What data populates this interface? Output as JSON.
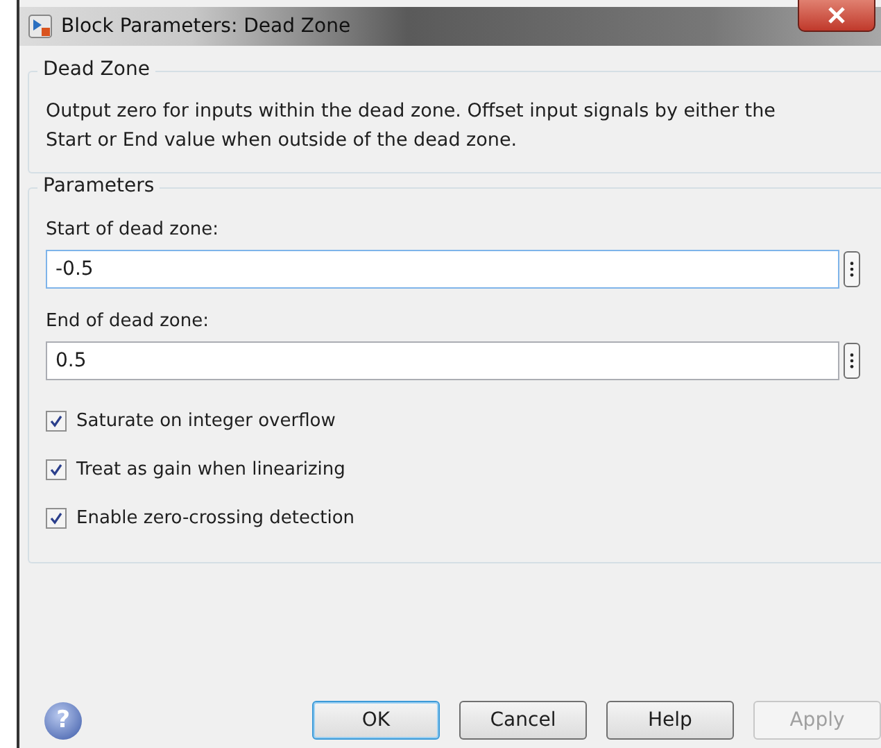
{
  "window": {
    "title": "Block Parameters: Dead Zone"
  },
  "description_group": {
    "title": "Dead Zone",
    "text": "Output zero for inputs within the dead zone.  Offset input signals by either the Start or End value when outside of the dead zone."
  },
  "parameters_group": {
    "title": "Parameters",
    "fields": [
      {
        "label": "Start of dead zone:",
        "value": "-0.5",
        "focused": true
      },
      {
        "label": "End of dead zone:",
        "value": "0.5",
        "focused": false
      }
    ],
    "checkboxes": [
      {
        "label": "Saturate on integer overflow",
        "checked": true
      },
      {
        "label": "Treat as gain when linearizing",
        "checked": true
      },
      {
        "label": "Enable zero-crossing detection",
        "checked": true
      }
    ]
  },
  "help_glyph": "?",
  "buttons": [
    {
      "label": "OK",
      "focused": true,
      "disabled": false
    },
    {
      "label": "Cancel",
      "focused": false,
      "disabled": false
    },
    {
      "label": "Help",
      "focused": false,
      "disabled": false
    },
    {
      "label": "Apply",
      "focused": false,
      "disabled": true
    }
  ]
}
